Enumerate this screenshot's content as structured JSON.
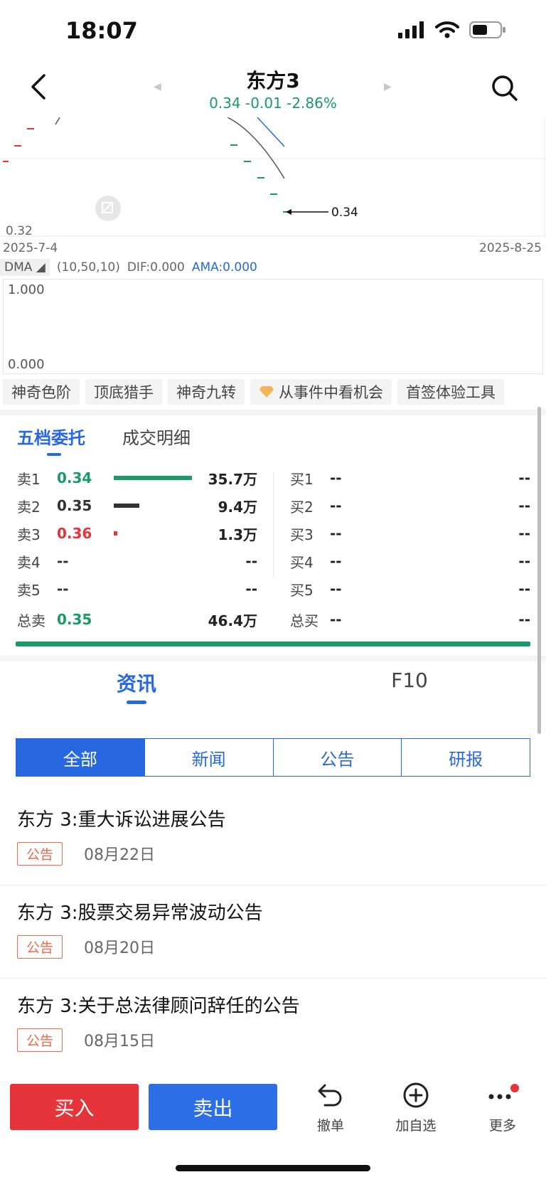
{
  "status_bar": {
    "time": "18:07"
  },
  "nav": {
    "title": "东方3",
    "subtitle": "0.34 -0.01 -2.86%"
  },
  "chart": {
    "y_min_label": "0.32",
    "x_start": "2025-7-4",
    "x_end": "2025-8-25",
    "last_price_label": "0.34"
  },
  "dma": {
    "name": "DMA",
    "params": "(10,50,10)",
    "dif": "DIF:0.000",
    "ama": "AMA:0.000",
    "y_top": "1.000",
    "y_bottom": "0.000"
  },
  "chips": [
    "神奇色阶",
    "顶底猎手",
    "神奇九转",
    "从事件中看机会",
    "首签体验工具"
  ],
  "order_book": {
    "tabs": [
      "五档委托",
      "成交明细"
    ],
    "sell": [
      {
        "label": "卖1",
        "price": "0.34",
        "volume": "35.7万",
        "level": 1.0,
        "color": "#1a9b66"
      },
      {
        "label": "卖2",
        "price": "0.35",
        "volume": "9.4万",
        "level": 0.33,
        "color": "#333333"
      },
      {
        "label": "卖3",
        "price": "0.36",
        "volume": "1.3万",
        "level": 0.05,
        "color": "#e5343a"
      },
      {
        "label": "卖4",
        "price": "--",
        "volume": "--",
        "level": 0,
        "color": "#333333"
      },
      {
        "label": "卖5",
        "price": "--",
        "volume": "--",
        "level": 0,
        "color": "#333333"
      }
    ],
    "buy": [
      {
        "label": "买1",
        "price": "--",
        "volume": "--"
      },
      {
        "label": "买2",
        "price": "--",
        "volume": "--"
      },
      {
        "label": "买3",
        "price": "--",
        "volume": "--"
      },
      {
        "label": "买4",
        "price": "--",
        "volume": "--"
      },
      {
        "label": "买5",
        "price": "--",
        "volume": "--"
      }
    ],
    "total_sell": {
      "label": "总卖",
      "price": "0.35",
      "volume": "46.4万"
    },
    "total_buy": {
      "label": "总买",
      "price": "--",
      "volume": "--"
    }
  },
  "news_tabs": [
    "资讯",
    "F10"
  ],
  "segments": [
    "全部",
    "新闻",
    "公告",
    "研报"
  ],
  "news": [
    {
      "title": "东方 3:重大诉讼进展公告",
      "tag": "公告",
      "date": "08月22日"
    },
    {
      "title": "东方 3:股票交易异常波动公告",
      "tag": "公告",
      "date": "08月20日"
    },
    {
      "title": "东方 3:关于总法律顾问辞任的公告",
      "tag": "公告",
      "date": "08月15日"
    }
  ],
  "bottom": {
    "buy": "买入",
    "sell": "卖出",
    "cancel": "撤单",
    "add_watch": "加自选",
    "more": "更多"
  },
  "colors": {
    "up": "#e5343a",
    "down": "#1a9b66",
    "accent": "#2768e0"
  }
}
